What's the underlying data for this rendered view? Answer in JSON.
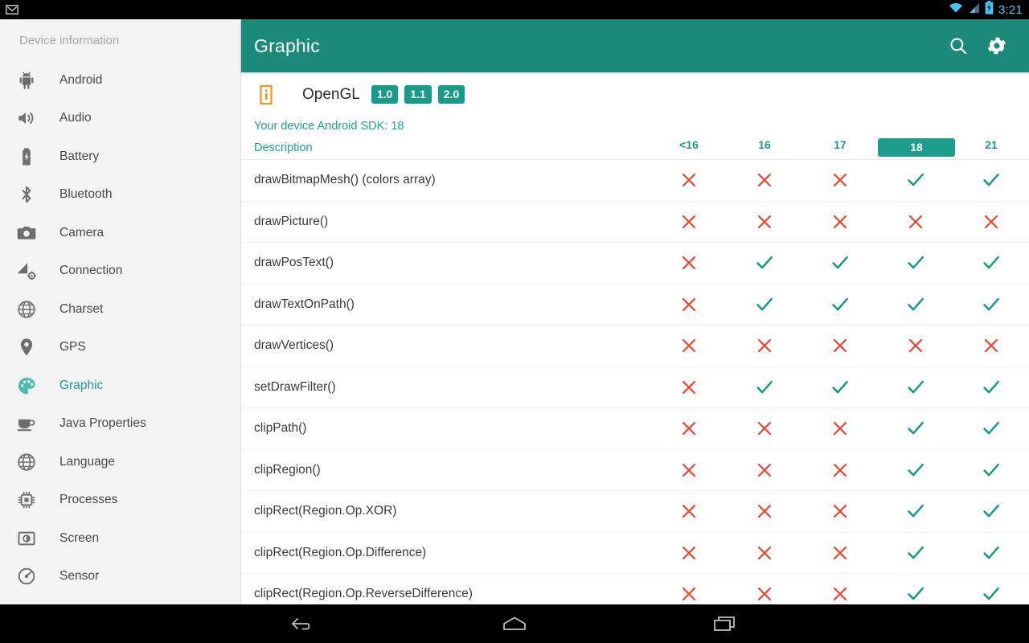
{
  "statusbar": {
    "notification_icon": "gmail-icon",
    "wifi_icon": "wifi-icon",
    "signal_icon": "cell-signal-icon",
    "battery_icon": "battery-charging-icon",
    "time": "3:21"
  },
  "sidebar": {
    "title": "Device information",
    "items": [
      {
        "label": "Android",
        "icon": "android-robot-icon",
        "selected": false
      },
      {
        "label": "Audio",
        "icon": "speaker-icon",
        "selected": false
      },
      {
        "label": "Battery",
        "icon": "battery-icon",
        "selected": false
      },
      {
        "label": "Bluetooth",
        "icon": "bluetooth-icon",
        "selected": false
      },
      {
        "label": "Camera",
        "icon": "camera-icon",
        "selected": false
      },
      {
        "label": "Connection",
        "icon": "connection-icon",
        "selected": false
      },
      {
        "label": "Charset",
        "icon": "globe-icon",
        "selected": false
      },
      {
        "label": "GPS",
        "icon": "location-pin-icon",
        "selected": false
      },
      {
        "label": "Graphic",
        "icon": "palette-icon",
        "selected": true
      },
      {
        "label": "Java Properties",
        "icon": "coffee-cup-icon",
        "selected": false
      },
      {
        "label": "Language",
        "icon": "globe-icon",
        "selected": false
      },
      {
        "label": "Processes",
        "icon": "cpu-chip-icon",
        "selected": false
      },
      {
        "label": "Screen",
        "icon": "screen-icon",
        "selected": false
      },
      {
        "label": "Sensor",
        "icon": "sensor-icon",
        "selected": false
      }
    ]
  },
  "appbar": {
    "title": "Graphic",
    "search_icon": "search-icon",
    "settings_icon": "gear-icon",
    "background_color": "#1b8a7a"
  },
  "opengl": {
    "info_icon": "info-icon",
    "label": "OpenGL",
    "versions": [
      "1.0",
      "1.1",
      "2.0"
    ],
    "badge_color": "#189b8a"
  },
  "sdk_note": "Your device Android SDK: 18",
  "table": {
    "description_header": "Description",
    "columns": [
      "<16",
      "16",
      "17",
      "18",
      "21"
    ],
    "current_column": "18",
    "yes_glyph": "check-icon",
    "no_glyph": "cross-icon",
    "yes_color": "#139b87",
    "no_color": "#f4422e",
    "rows": [
      {
        "description": "drawBitmapMesh() (colors array)",
        "support": [
          false,
          false,
          false,
          true,
          true
        ]
      },
      {
        "description": "drawPicture()",
        "support": [
          false,
          false,
          false,
          false,
          false
        ]
      },
      {
        "description": "drawPosText()",
        "support": [
          false,
          true,
          true,
          true,
          true
        ]
      },
      {
        "description": "drawTextOnPath()",
        "support": [
          false,
          true,
          true,
          true,
          true
        ]
      },
      {
        "description": "drawVertices()",
        "support": [
          false,
          false,
          false,
          false,
          false
        ]
      },
      {
        "description": "setDrawFilter()",
        "support": [
          false,
          true,
          true,
          true,
          true
        ]
      },
      {
        "description": "clipPath()",
        "support": [
          false,
          false,
          false,
          true,
          true
        ]
      },
      {
        "description": "clipRegion()",
        "support": [
          false,
          false,
          false,
          true,
          true
        ]
      },
      {
        "description": "clipRect(Region.Op.XOR)",
        "support": [
          false,
          false,
          false,
          true,
          true
        ]
      },
      {
        "description": "clipRect(Region.Op.Difference)",
        "support": [
          false,
          false,
          false,
          true,
          true
        ]
      },
      {
        "description": "clipRect(Region.Op.ReverseDifference)",
        "support": [
          false,
          false,
          false,
          true,
          true
        ]
      }
    ]
  },
  "navbar": {
    "back": "back-icon",
    "home": "home-icon",
    "recents": "recents-icon"
  }
}
